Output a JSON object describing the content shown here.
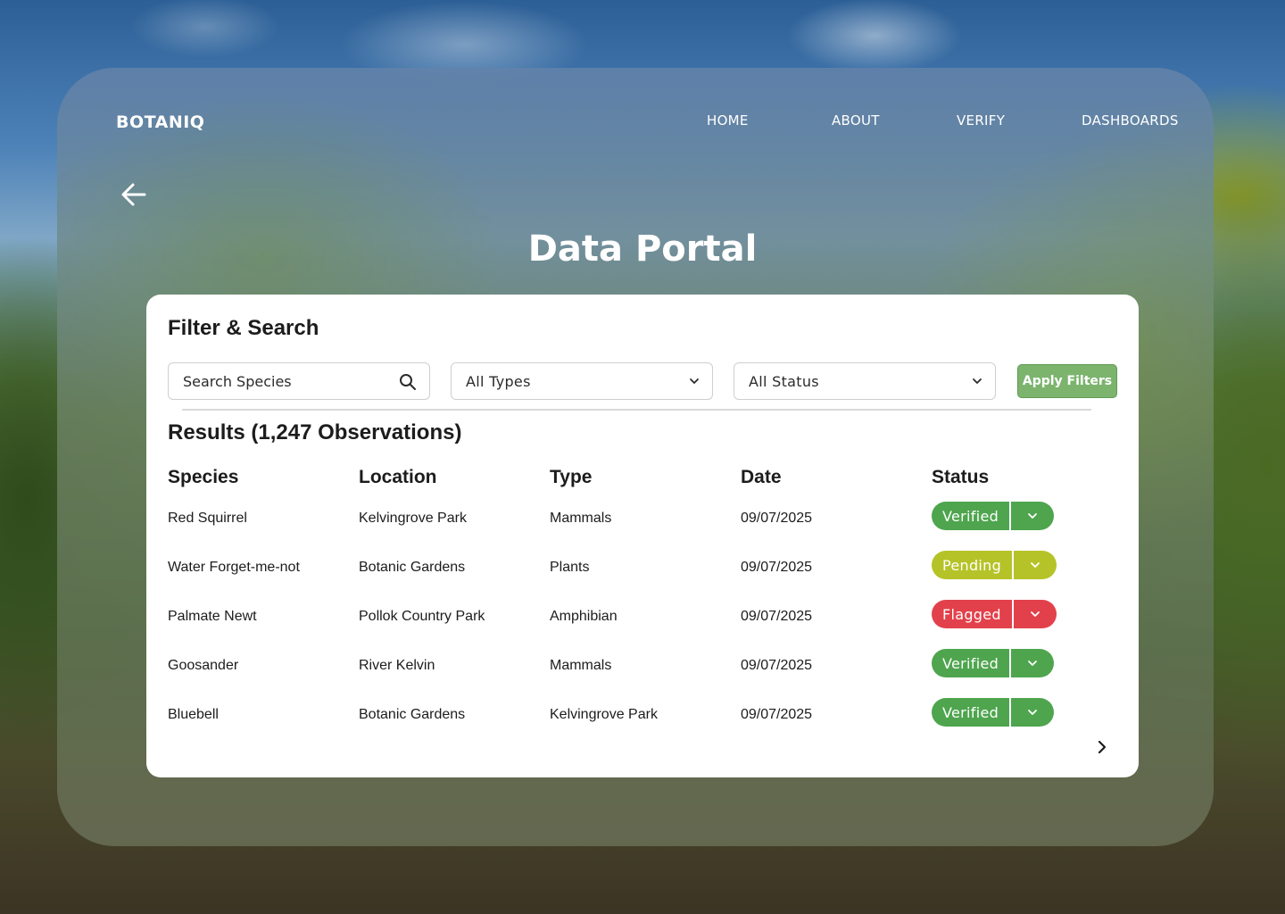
{
  "brand": "BOTANIQ",
  "nav": [
    "HOME",
    "ABOUT",
    "VERIFY",
    "DASHBOARDS"
  ],
  "title": "Data Portal",
  "filter": {
    "heading": "Filter & Search",
    "search_placeholder": "Search Species",
    "type_value": "All Types",
    "status_value": "All Status",
    "apply_label": "Apply Filters"
  },
  "results_heading": "Results (1,247 Observations)",
  "columns": [
    "Species",
    "Location",
    "Type",
    "Date",
    "Status"
  ],
  "rows": [
    {
      "species": "Red Squirrel",
      "location": "Kelvingrove Park",
      "type": "Mammals",
      "date": "09/07/2025",
      "status": "Verified"
    },
    {
      "species": "Water Forget-me-not",
      "location": "Botanic Gardens",
      "type": "Plants",
      "date": "09/07/2025",
      "status": "Pending"
    },
    {
      "species": "Palmate Newt",
      "location": "Pollok Country Park",
      "type": "Amphibian",
      "date": "09/07/2025",
      "status": "Flagged"
    },
    {
      "species": "Goosander",
      "location": "River Kelvin",
      "type": "Mammals",
      "date": "09/07/2025",
      "status": "Verified"
    },
    {
      "species": "Bluebell",
      "location": "Botanic Gardens",
      "type": "Kelvingrove Park",
      "date": "09/07/2025",
      "status": "Verified"
    }
  ],
  "status_colors": {
    "Verified": "#4ea54e",
    "Pending": "#b6c328",
    "Flagged": "#e2414b"
  },
  "colors": {
    "apply_button": "#7cb46e"
  },
  "icons": {
    "back": "arrow-left-icon",
    "search": "search-icon",
    "dropdown": "chevron-down-icon",
    "next_page": "chevron-right-icon"
  }
}
